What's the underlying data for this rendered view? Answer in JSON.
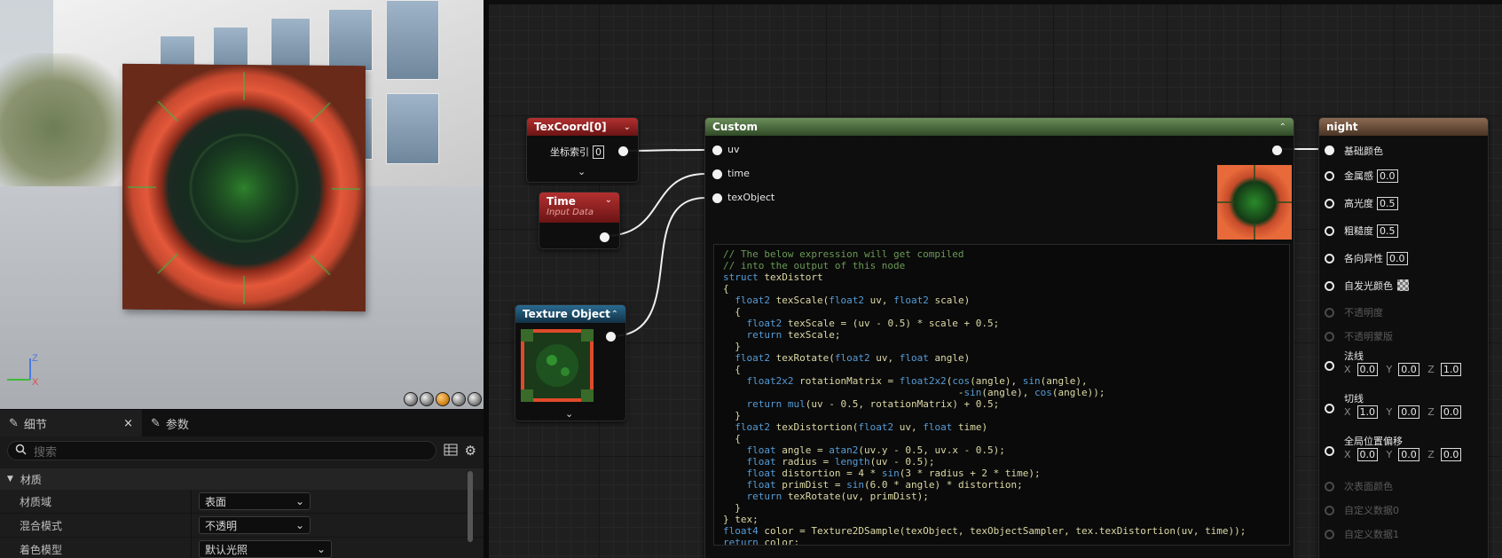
{
  "viewport": {
    "gizmo": {
      "z": "Z",
      "x": "X"
    },
    "toolbar_icons": [
      "sphere-preview-icon",
      "cube-preview-icon",
      "plane-preview-icon",
      "cylinder-preview-icon",
      "custom-mesh-preview-icon"
    ]
  },
  "details_panel": {
    "tabs": [
      {
        "label": "细节",
        "icon": "pencil-icon",
        "active": true,
        "close": "×"
      },
      {
        "label": "参数",
        "icon": "pencil-icon",
        "active": false
      }
    ],
    "search_placeholder": "搜索",
    "section": "材质",
    "properties": [
      {
        "label": "材质域",
        "value": "表面"
      },
      {
        "label": "混合模式",
        "value": "不透明"
      },
      {
        "label": "着色模型",
        "value": "默认光照"
      }
    ]
  },
  "graph": {
    "texcoord_node": {
      "title": "TexCoord[0]",
      "index_label": "坐标索引",
      "index_value": "0"
    },
    "time_node": {
      "title": "Time",
      "subtitle": "Input Data"
    },
    "texture_object_node": {
      "title": "Texture Object"
    },
    "custom_node": {
      "title": "Custom",
      "inputs": [
        "uv",
        "time",
        "texObject"
      ]
    },
    "material_node": {
      "title": "night",
      "pins": [
        {
          "label": "基础颜色",
          "enabled": true
        },
        {
          "label": "金属感",
          "enabled": true,
          "value": "0.0"
        },
        {
          "label": "高光度",
          "enabled": true,
          "value": "0.5"
        },
        {
          "label": "粗糙度",
          "enabled": true,
          "value": "0.5"
        },
        {
          "label": "各向异性",
          "enabled": true,
          "value": "0.0"
        },
        {
          "label": "自发光颜色",
          "enabled": true
        },
        {
          "label": "不透明度",
          "enabled": false
        },
        {
          "label": "不透明蒙版",
          "enabled": false
        },
        {
          "label": "法线",
          "enabled": true,
          "vec": [
            "0.0",
            "0.0",
            "1.0"
          ]
        },
        {
          "label": "切线",
          "enabled": true,
          "vec": [
            "1.0",
            "0.0",
            "0.0"
          ]
        },
        {
          "label": "全局位置偏移",
          "enabled": true,
          "vec": [
            "0.0",
            "0.0",
            "0.0"
          ]
        },
        {
          "label": "次表面颜色",
          "enabled": false
        },
        {
          "label": "自定义数据0",
          "enabled": false
        },
        {
          "label": "自定义数据1",
          "enabled": false
        }
      ],
      "axes": [
        "X",
        "Y",
        "Z"
      ]
    }
  }
}
